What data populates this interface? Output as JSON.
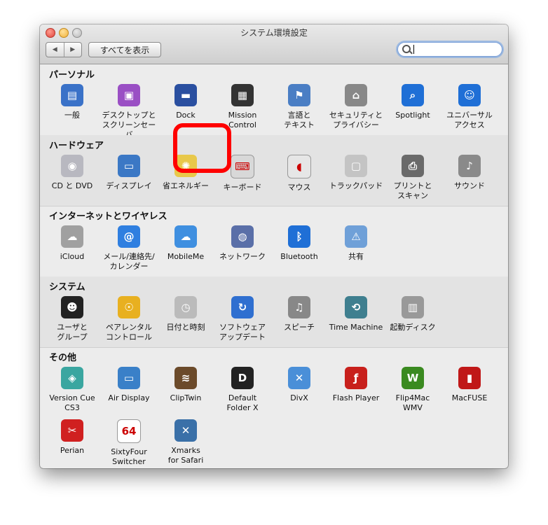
{
  "window": {
    "title": "システム環境設定"
  },
  "toolbar": {
    "back": "◀",
    "forward": "▶",
    "show_all": "すべてを表示"
  },
  "sections": [
    {
      "title": "パーソナル",
      "items": [
        {
          "label": "一般",
          "icon": "general-icon",
          "color": "#3a72c8"
        },
        {
          "label": "デスクトップと\nスクリーンセーバ",
          "icon": "desktop-icon",
          "color": "#9a4fc4"
        },
        {
          "label": "Dock",
          "icon": "dock-icon",
          "color": "#2a4fa0"
        },
        {
          "label": "Mission\nControl",
          "icon": "mission-control-icon",
          "color": "#333333"
        },
        {
          "label": "言語と\nテキスト",
          "icon": "language-icon",
          "color": "#4a7ec4"
        },
        {
          "label": "セキュリティと\nプライバシー",
          "icon": "security-icon",
          "color": "#888888"
        },
        {
          "label": "Spotlight",
          "icon": "spotlight-icon",
          "color": "#1f6fd6"
        },
        {
          "label": "ユニバーサル\nアクセス",
          "icon": "universal-access-icon",
          "color": "#1f6fd6"
        }
      ]
    },
    {
      "title": "ハードウェア",
      "items": [
        {
          "label": "CD と DVD",
          "icon": "cd-dvd-icon",
          "color": "#b8b8c0"
        },
        {
          "label": "ディスプレイ",
          "icon": "display-icon",
          "color": "#3b78c5"
        },
        {
          "label": "省エネルギー",
          "icon": "energy-saver-icon",
          "color": "#e8c84a"
        },
        {
          "label": "キーボード",
          "icon": "keyboard-icon",
          "color": "#d8d8d8"
        },
        {
          "label": "マウス",
          "icon": "mouse-icon",
          "color": "#e6e6e6"
        },
        {
          "label": "トラックパッド",
          "icon": "trackpad-icon",
          "color": "#c4c4c4"
        },
        {
          "label": "プリントと\nスキャン",
          "icon": "printer-icon",
          "color": "#6a6a6a"
        },
        {
          "label": "サウンド",
          "icon": "sound-icon",
          "color": "#8a8a8a"
        }
      ]
    },
    {
      "title": "インターネットとワイヤレス",
      "items": [
        {
          "label": "iCloud",
          "icon": "icloud-icon",
          "color": "#a0a0a0"
        },
        {
          "label": "メール/連絡先/\nカレンダー",
          "icon": "mail-contacts-icon",
          "color": "#2f7fe0"
        },
        {
          "label": "MobileMe",
          "icon": "mobileme-icon",
          "color": "#3f8fe0"
        },
        {
          "label": "ネットワーク",
          "icon": "network-icon",
          "color": "#5a6fa8"
        },
        {
          "label": "Bluetooth",
          "icon": "bluetooth-icon",
          "color": "#1f6fd6"
        },
        {
          "label": "共有",
          "icon": "sharing-icon",
          "color": "#6fa0d8"
        }
      ]
    },
    {
      "title": "システム",
      "items": [
        {
          "label": "ユーザと\nグループ",
          "icon": "users-groups-icon",
          "color": "#222222"
        },
        {
          "label": "ペアレンタル\nコントロール",
          "icon": "parental-controls-icon",
          "color": "#e8b020"
        },
        {
          "label": "日付と時刻",
          "icon": "date-time-icon",
          "color": "#bbbbbb"
        },
        {
          "label": "ソフトウェア\nアップデート",
          "icon": "software-update-icon",
          "color": "#2f6fd0"
        },
        {
          "label": "スピーチ",
          "icon": "speech-icon",
          "color": "#888888"
        },
        {
          "label": "Time Machine",
          "icon": "time-machine-icon",
          "color": "#3f7f8f"
        },
        {
          "label": "起動ディスク",
          "icon": "startup-disk-icon",
          "color": "#999999"
        }
      ]
    },
    {
      "title": "その他",
      "items": [
        {
          "label": "Version Cue\nCS3",
          "icon": "version-cue-icon",
          "color": "#3aa6a0"
        },
        {
          "label": "Air Display",
          "icon": "air-display-icon",
          "color": "#3a80c8"
        },
        {
          "label": "ClipTwin",
          "icon": "cliptwin-icon",
          "color": "#6b4a2a"
        },
        {
          "label": "Default\nFolder X",
          "icon": "default-folder-icon",
          "color": "#222222"
        },
        {
          "label": "DivX",
          "icon": "divx-icon",
          "color": "#4a8fd8"
        },
        {
          "label": "Flash Player",
          "icon": "flash-player-icon",
          "color": "#c8201c"
        },
        {
          "label": "Flip4Mac\nWMV",
          "icon": "flip4mac-icon",
          "color": "#3a8a20"
        },
        {
          "label": "MacFUSE",
          "icon": "macfuse-icon",
          "color": "#c01818"
        },
        {
          "label": "Perian",
          "icon": "perian-icon",
          "color": "#d02020"
        },
        {
          "label": "SixtyFour Switcher",
          "icon": "sixtyfour-icon",
          "color": "#ffffff"
        },
        {
          "label": "Xmarks\nfor Safari",
          "icon": "xmarks-icon",
          "color": "#3a70a8"
        }
      ]
    }
  ],
  "glyphs": {
    "general-icon": "▤",
    "desktop-icon": "▣",
    "dock-icon": "▬",
    "mission-control-icon": "▦",
    "language-icon": "⚑",
    "security-icon": "⌂",
    "spotlight-icon": "⌕",
    "universal-access-icon": "☺",
    "cd-dvd-icon": "◉",
    "display-icon": "▭",
    "energy-saver-icon": "✺",
    "keyboard-icon": "⌨",
    "mouse-icon": "◖",
    "trackpad-icon": "▢",
    "printer-icon": "⎙",
    "sound-icon": "♪",
    "icloud-icon": "☁",
    "mail-contacts-icon": "@",
    "mobileme-icon": "☁",
    "network-icon": "◍",
    "bluetooth-icon": "ᛒ",
    "sharing-icon": "⚠",
    "users-groups-icon": "☻",
    "parental-controls-icon": "☉",
    "date-time-icon": "◷",
    "software-update-icon": "↻",
    "speech-icon": "♫",
    "time-machine-icon": "⟲",
    "startup-disk-icon": "▥",
    "version-cue-icon": "◈",
    "air-display-icon": "▭",
    "cliptwin-icon": "≋",
    "default-folder-icon": "D",
    "divx-icon": "✕",
    "flash-player-icon": "ƒ",
    "flip4mac-icon": "W",
    "macfuse-icon": "▮",
    "perian-icon": "✂",
    "sixtyfour-icon": "64",
    "xmarks-icon": "✕"
  }
}
